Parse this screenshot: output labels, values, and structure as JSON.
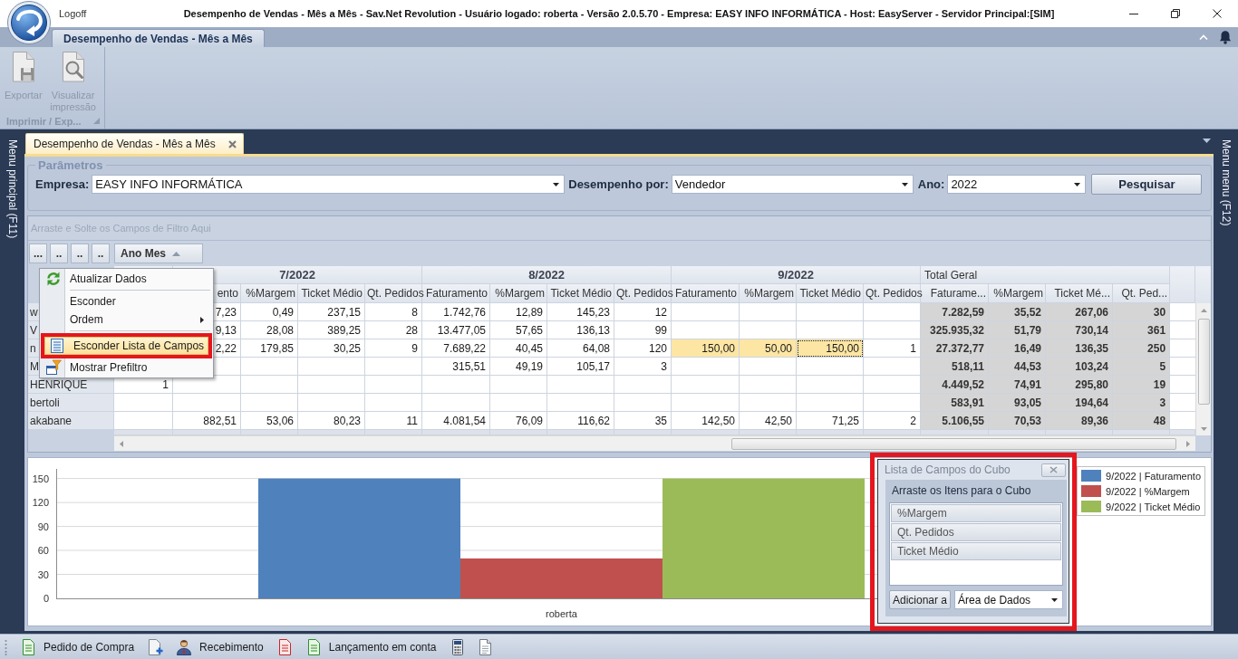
{
  "window": {
    "logoff": "Logoff",
    "title": "Desempenho de Vendas - Mês a Mês - Sav.Net Revolution - Usuário logado: roberta - Versão 2.0.5.70 - Empresa: EASY INFO INFORMÁTICA - Host: EasyServer - Servidor Principal:[SIM]"
  },
  "ribbon": {
    "tabs": [
      {
        "label": "Desempenho de Vendas - Mês a Mês",
        "selected": true
      }
    ],
    "groups": [
      {
        "label": "Imprimir / Exp...",
        "buttons": [
          {
            "label": "Exportar",
            "disabled": true
          },
          {
            "label": "Visualizar impressão",
            "disabled": true
          }
        ]
      }
    ]
  },
  "side_panels": {
    "left": "Menu principal (F11)",
    "right": "Menu menu (F12)"
  },
  "document_tabs": [
    {
      "label": "Desempenho de Vendas - Mês a Mês",
      "selected": true
    }
  ],
  "parameters": {
    "title": "Parâmetros",
    "fields": [
      {
        "label": "Empresa:",
        "value": "EASY INFO INFORMÁTICA"
      },
      {
        "label": "Desempenho por:",
        "value": "Vendedor"
      },
      {
        "label": "Ano:",
        "value": "2022"
      }
    ],
    "button": "Pesquisar"
  },
  "pivot": {
    "filter_area": {
      "placeholder": "Arraste e Solte os Campos de Filtro Aqui"
    },
    "data_fields": [
      "...",
      "..",
      "..",
      ".."
    ],
    "column_field": {
      "label": "Ano Mes",
      "sort_ascending": true
    },
    "column_groups": [
      {
        "kind": "month",
        "columns": [
          null
        ]
      },
      {
        "kind": "month",
        "label": "7/2022",
        "columns": [
          "ento",
          "%Margem",
          "Ticket Médio",
          "Qt. Pedidos"
        ]
      },
      {
        "kind": "month",
        "label": "8/2022",
        "columns": [
          "Faturamento",
          "%Margem",
          "Ticket Médio",
          "Qt. Pedidos"
        ]
      },
      {
        "kind": "month",
        "label": "9/2022",
        "columns": [
          "Faturamento",
          "%Margem",
          "Ticket Médio",
          "Qt. Pedidos"
        ]
      },
      {
        "kind": "total",
        "label": "Total Geral",
        "columns": [
          "Faturame...",
          "%Margem",
          "Ticket Mé...",
          "Qt. Ped..."
        ]
      }
    ],
    "rows": [
      {
        "label": "w",
        "cells": [
          null,
          {
            "value": "7,23",
            "selected": false,
            "focused": false
          },
          {
            "value": "0,49",
            "selected": false,
            "focused": false
          },
          {
            "value": "237,15",
            "selected": false,
            "focused": false
          },
          {
            "value": "8",
            "selected": false,
            "focused": false
          },
          {
            "value": "1.742,76",
            "selected": false,
            "focused": false
          },
          {
            "value": "12,89",
            "selected": false,
            "focused": false
          },
          {
            "value": "145,23",
            "selected": false,
            "focused": false
          },
          {
            "value": "12",
            "selected": false,
            "focused": false
          },
          {
            "selected": false,
            "focused": false
          },
          {
            "selected": false,
            "focused": false
          },
          {
            "selected": false,
            "focused": false
          },
          {
            "selected": false,
            "focused": false
          },
          {
            "value": "7.282,59",
            "selected": false,
            "focused": false
          },
          {
            "value": "35,52",
            "selected": false,
            "focused": false
          },
          {
            "value": "267,06",
            "selected": false,
            "focused": false
          },
          {
            "value": "30",
            "selected": false,
            "focused": false
          }
        ]
      },
      {
        "label": "V",
        "cells": [
          null,
          {
            "value": "9,13",
            "selected": false,
            "focused": false
          },
          {
            "value": "28,08",
            "selected": false,
            "focused": false
          },
          {
            "value": "389,25",
            "selected": false,
            "focused": false
          },
          {
            "value": "28",
            "selected": false,
            "focused": false
          },
          {
            "value": "13.477,05",
            "selected": false,
            "focused": false
          },
          {
            "value": "57,65",
            "selected": false,
            "focused": false
          },
          {
            "value": "136,13",
            "selected": false,
            "focused": false
          },
          {
            "value": "99",
            "selected": false,
            "focused": false
          },
          {
            "selected": false,
            "focused": false
          },
          {
            "selected": false,
            "focused": false
          },
          {
            "selected": false,
            "focused": false
          },
          {
            "selected": false,
            "focused": false
          },
          {
            "value": "325.935,32",
            "selected": false,
            "focused": false
          },
          {
            "value": "51,79",
            "selected": false,
            "focused": false
          },
          {
            "value": "730,14",
            "selected": false,
            "focused": false
          },
          {
            "value": "361",
            "selected": false,
            "focused": false
          }
        ]
      },
      {
        "label": "n",
        "cells": [
          null,
          {
            "value": "2,22",
            "selected": false,
            "focused": false
          },
          {
            "value": "179,85",
            "selected": false,
            "focused": false
          },
          {
            "value": "30,25",
            "selected": false,
            "focused": false
          },
          {
            "value": "9",
            "selected": false,
            "focused": false
          },
          {
            "value": "7.689,22",
            "selected": false,
            "focused": false
          },
          {
            "value": "40,45",
            "selected": false,
            "focused": false
          },
          {
            "value": "64,08",
            "selected": false,
            "focused": false
          },
          {
            "value": "120",
            "selected": false,
            "focused": false
          },
          {
            "value": "150,00",
            "selected": true,
            "focused": false
          },
          {
            "value": "50,00",
            "selected": true,
            "focused": false
          },
          {
            "value": "150,00",
            "selected": true,
            "focused": true
          },
          {
            "value": "1",
            "selected": false,
            "focused": false
          },
          {
            "value": "27.372,77",
            "selected": false,
            "focused": false
          },
          {
            "value": "16,49",
            "selected": false,
            "focused": false
          },
          {
            "value": "136,35",
            "selected": false,
            "focused": false
          },
          {
            "value": "250",
            "selected": false,
            "focused": false
          }
        ]
      },
      {
        "label": "M",
        "cells": [
          null,
          {
            "selected": false,
            "focused": false
          },
          {
            "selected": false,
            "focused": false
          },
          {
            "selected": false,
            "focused": false
          },
          {
            "selected": false,
            "focused": false
          },
          {
            "value": "315,51",
            "selected": false,
            "focused": false
          },
          {
            "value": "49,19",
            "selected": false,
            "focused": false
          },
          {
            "value": "105,17",
            "selected": false,
            "focused": false
          },
          {
            "value": "3",
            "selected": false,
            "focused": false
          },
          {
            "selected": false,
            "focused": false
          },
          {
            "selected": false,
            "focused": false
          },
          {
            "selected": false,
            "focused": false
          },
          {
            "selected": false,
            "focused": false
          },
          {
            "value": "518,11",
            "selected": false,
            "focused": false
          },
          {
            "value": "44,53",
            "selected": false,
            "focused": false
          },
          {
            "value": "103,24",
            "selected": false,
            "focused": false
          },
          {
            "value": "5",
            "selected": false,
            "focused": false
          }
        ]
      },
      {
        "label": "HENRIQUE",
        "cells": [
          {
            "value": "1",
            "selected": false,
            "focused": false
          },
          {
            "selected": false,
            "focused": false
          },
          {
            "selected": false,
            "focused": false
          },
          {
            "selected": false,
            "focused": false
          },
          {
            "selected": false,
            "focused": false
          },
          {
            "selected": false,
            "focused": false
          },
          {
            "selected": false,
            "focused": false
          },
          {
            "selected": false,
            "focused": false
          },
          {
            "selected": false,
            "focused": false
          },
          {
            "selected": false,
            "focused": false
          },
          {
            "selected": false,
            "focused": false
          },
          {
            "selected": false,
            "focused": false
          },
          {
            "selected": false,
            "focused": false
          },
          {
            "value": "4.449,52",
            "selected": false,
            "focused": false
          },
          {
            "value": "74,91",
            "selected": false,
            "focused": false
          },
          {
            "value": "295,80",
            "selected": false,
            "focused": false
          },
          {
            "value": "19",
            "selected": false,
            "focused": false
          }
        ]
      },
      {
        "label": "bertoli",
        "cells": [
          {
            "selected": false,
            "focused": false
          },
          {
            "selected": false,
            "focused": false
          },
          {
            "selected": false,
            "focused": false
          },
          {
            "selected": false,
            "focused": false
          },
          {
            "selected": false,
            "focused": false
          },
          {
            "selected": false,
            "focused": false
          },
          {
            "selected": false,
            "focused": false
          },
          {
            "selected": false,
            "focused": false
          },
          {
            "selected": false,
            "focused": false
          },
          {
            "selected": false,
            "focused": false
          },
          {
            "selected": false,
            "focused": false
          },
          {
            "selected": false,
            "focused": false
          },
          {
            "selected": false,
            "focused": false
          },
          {
            "value": "583,91",
            "selected": false,
            "focused": false
          },
          {
            "value": "93,05",
            "selected": false,
            "focused": false
          },
          {
            "value": "194,64",
            "selected": false,
            "focused": false
          },
          {
            "value": "3",
            "selected": false,
            "focused": false
          }
        ]
      },
      {
        "label": "akabane",
        "cells": [
          {
            "selected": false,
            "focused": false
          },
          {
            "value": "882,51",
            "selected": false,
            "focused": false
          },
          {
            "value": "53,06",
            "selected": false,
            "focused": false
          },
          {
            "value": "80,23",
            "selected": false,
            "focused": false
          },
          {
            "value": "11",
            "selected": false,
            "focused": false
          },
          {
            "value": "4.081,54",
            "selected": false,
            "focused": false
          },
          {
            "value": "76,09",
            "selected": false,
            "focused": false
          },
          {
            "value": "116,62",
            "selected": false,
            "focused": false
          },
          {
            "value": "35",
            "selected": false,
            "focused": false
          },
          {
            "value": "142,50",
            "selected": false,
            "focused": false
          },
          {
            "value": "42,50",
            "selected": false,
            "focused": false
          },
          {
            "value": "71,25",
            "selected": false,
            "focused": false
          },
          {
            "value": "2",
            "selected": false,
            "focused": false
          },
          {
            "value": "5.106,55",
            "selected": false,
            "focused": false
          },
          {
            "value": "70,53",
            "selected": false,
            "focused": false
          },
          {
            "value": "89,36",
            "selected": false,
            "focused": false
          },
          {
            "value": "48",
            "selected": false,
            "focused": false
          }
        ]
      }
    ]
  },
  "context_menu": {
    "items": [
      {
        "label": "Atualizar Dados",
        "separator_before": false,
        "submenu": false,
        "selected": false,
        "framed": false
      },
      {
        "label": "Esconder",
        "separator_before": true,
        "submenu": false,
        "selected": false,
        "framed": false
      },
      {
        "label": "Ordem",
        "separator_before": false,
        "submenu": true,
        "selected": false,
        "framed": false
      },
      {
        "label": "Esconder Lista de Campos",
        "separator_before": true,
        "submenu": false,
        "selected": true,
        "framed": true
      },
      {
        "label": "Mostrar Prefiltro",
        "separator_before": false,
        "submenu": false,
        "selected": false,
        "framed": false
      }
    ]
  },
  "chart": {
    "chart_data": {
      "type": "bar",
      "grid": true,
      "categories": [
        "roberta"
      ],
      "series": [
        {
          "name": "9/2022 | Faturamento",
          "color": "#4f81bd",
          "values": [
            150
          ]
        },
        {
          "name": "9/2022 | %Margem",
          "color": "#c0504d",
          "values": [
            50
          ]
        },
        {
          "name": "9/2022 | Ticket Médio",
          "color": "#9bbb59",
          "values": [
            150
          ]
        }
      ],
      "ylim": [
        0,
        162
      ],
      "yticks": [
        0,
        30,
        60,
        90,
        120,
        150
      ]
    }
  },
  "field_list": {
    "title": "Lista de Campos do Cubo",
    "framed": true,
    "hint": "Arraste os Itens para o Cubo",
    "fields": [
      "%Margem",
      "Qt. Pedidos",
      "Ticket Médio"
    ],
    "add_button": "Adicionar a",
    "target": "Área de Dados"
  },
  "status_bar": {
    "buttons": [
      {
        "label": "Pedido de Compra"
      },
      {
        "label": "Recebimento"
      },
      {
        "label": "Lançamento em conta"
      }
    ]
  }
}
